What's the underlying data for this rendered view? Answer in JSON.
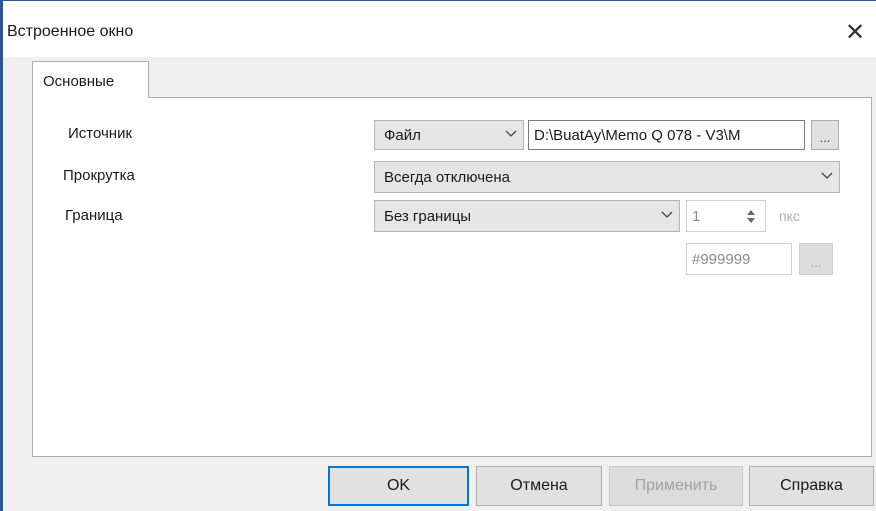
{
  "window": {
    "title": "Встроенное окно",
    "close_glyph": "✕"
  },
  "tabs": [
    {
      "label": "Основные",
      "active": true
    }
  ],
  "fields": {
    "source": {
      "label": "Источник",
      "type_value": "Файл",
      "path_value": "D:\\BuatAy\\Memo Q 078 - V3\\M",
      "browse_label": "..."
    },
    "scroll": {
      "label": "Прокрутка",
      "value": "Всегда отключена"
    },
    "border": {
      "label": "Граница",
      "style_value": "Без границы",
      "width_value": "1",
      "unit": "пкс",
      "color_value": "#999999",
      "color_browse_label": "..."
    }
  },
  "buttons": {
    "ok": "OK",
    "cancel": "Отмена",
    "apply": "Применить",
    "help": "Справка"
  },
  "colors": {
    "accent": "#0078d7",
    "frame": "#2b579a"
  }
}
